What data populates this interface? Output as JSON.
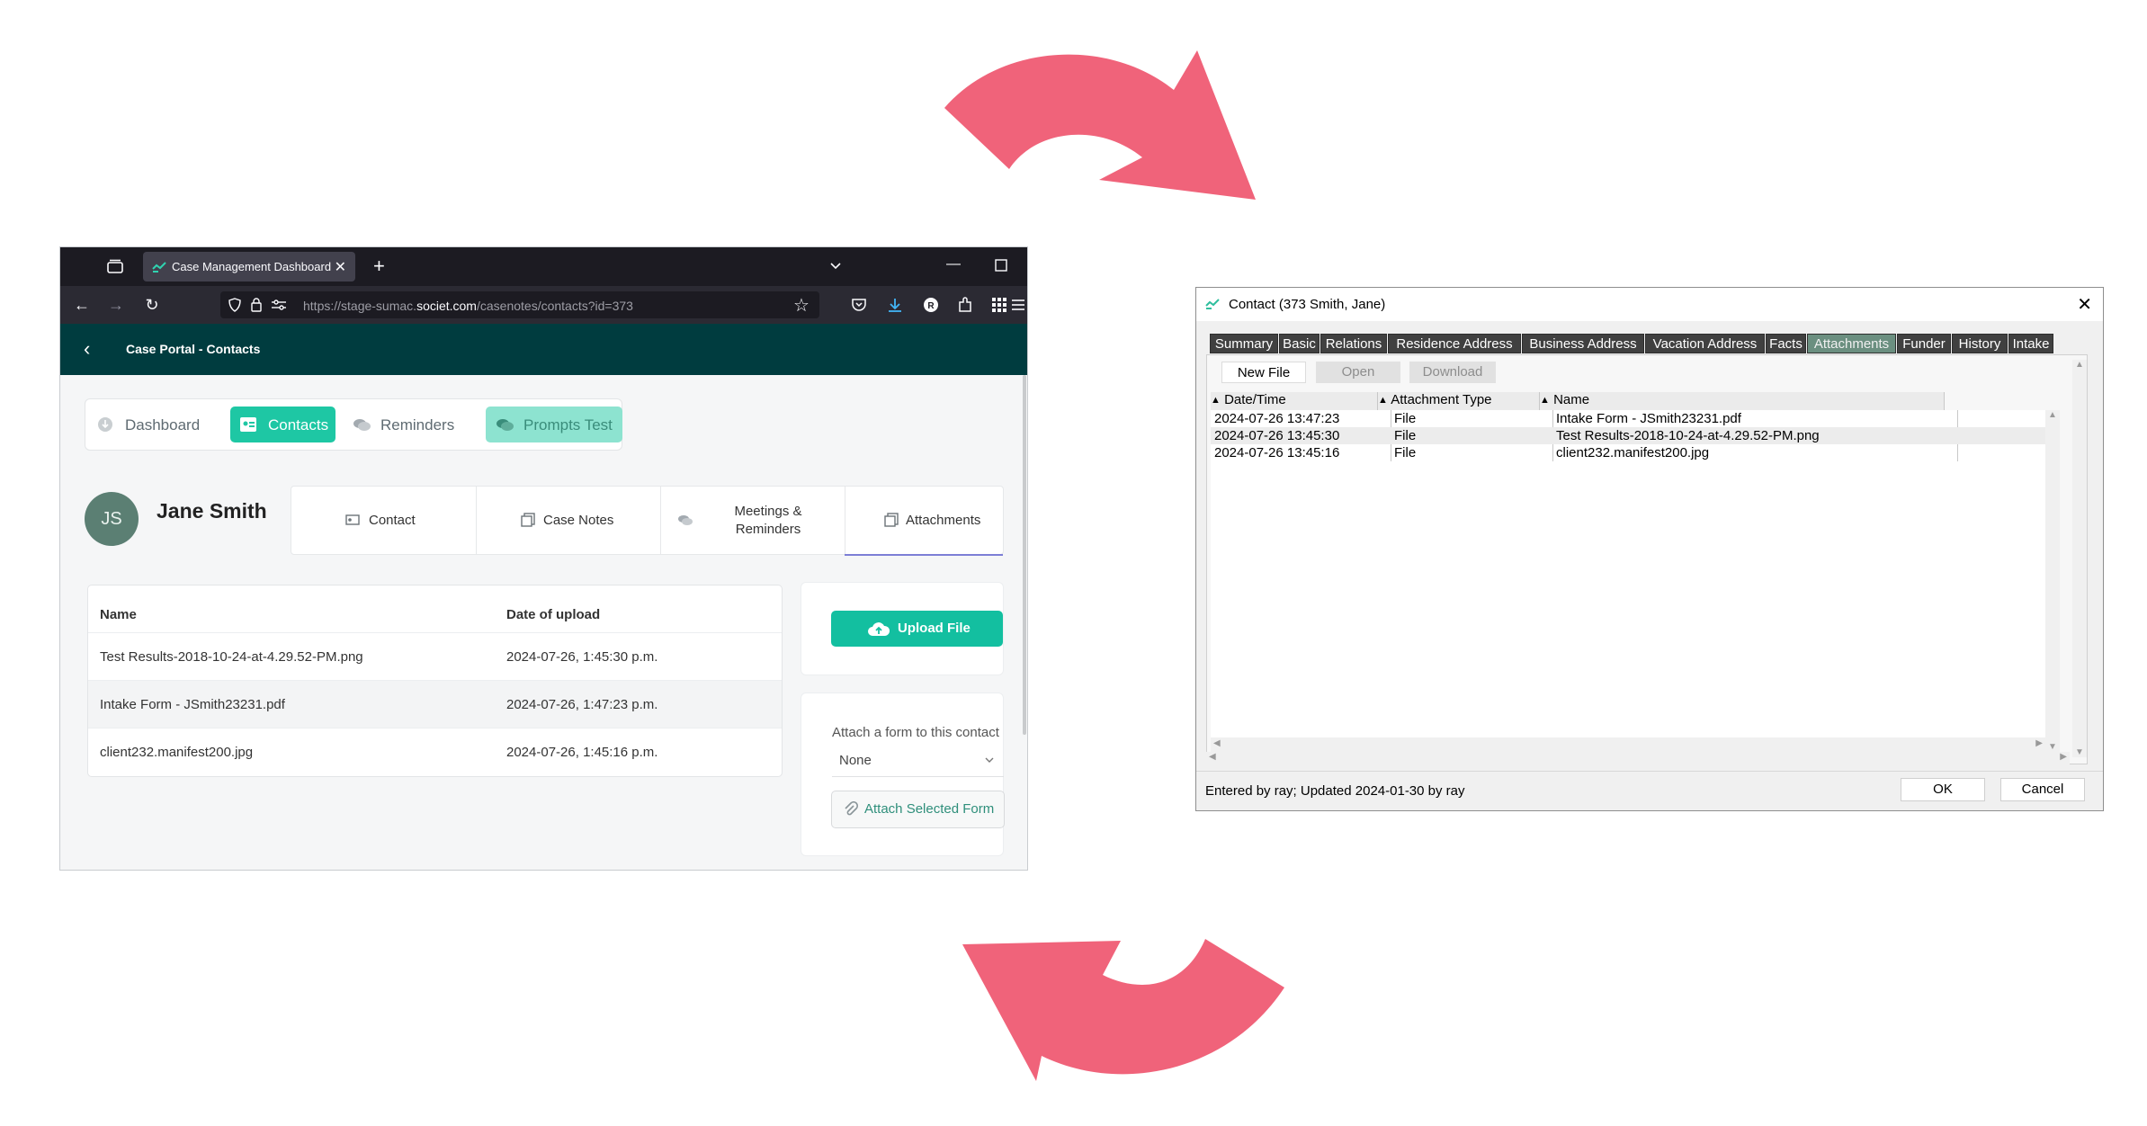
{
  "colors": {
    "arrow": "#f0637a",
    "browser_chrome": "#1c1b22",
    "app_header": "#003c3f",
    "accent": "#1ec7a4",
    "dialog_tab": "#404040",
    "dialog_tab_active": "#6b8f80"
  },
  "arrows": {
    "icon": "curved-arrow-icon",
    "count": 2
  },
  "browser": {
    "tab_title": "Case Management Dashboard",
    "url_prefix": "https://stage-sumac.",
    "url_domain": "societ.com",
    "url_path": "/casenotes/contacts?id=373",
    "icons": [
      "tab-list-icon",
      "close-icon",
      "plus-icon",
      "chevron-down-icon",
      "minimize-icon",
      "maximize-icon",
      "back-icon",
      "forward-icon",
      "reload-icon",
      "shield-icon",
      "lock-icon",
      "permissions-icon",
      "star-icon",
      "pocket-icon",
      "download-icon",
      "profile-icon",
      "extensions-icon",
      "apps-icon",
      "menu-icon"
    ]
  },
  "app": {
    "header_title": "Case Portal - Contacts",
    "nav": [
      "Dashboard",
      "Contacts",
      "Reminders",
      "Prompts Test"
    ],
    "avatar_initials": "JS",
    "contact_name": "Jane Smith",
    "subtabs": [
      {
        "label": "Contact"
      },
      {
        "label": "Case Notes"
      },
      {
        "label_line1": "Meetings &",
        "label_line2": "Reminders"
      },
      {
        "label": "Attachments"
      }
    ],
    "table": {
      "headers": [
        "Name",
        "Date of upload"
      ],
      "rows": [
        [
          "Test Results-2018-10-24-at-4.29.52-PM.png",
          "2024-07-26, 1:45:30 p.m."
        ],
        [
          "Intake Form - JSmith23231.pdf",
          "2024-07-26, 1:47:23 p.m."
        ],
        [
          "client232.manifest200.jpg",
          "2024-07-26, 1:45:16 p.m."
        ]
      ]
    },
    "upload_label": "Upload File",
    "attach_label": "Attach a form to this contact",
    "attach_select_value": "None",
    "attach_button": "Attach Selected Form"
  },
  "dialog": {
    "title": "Contact (373   Smith, Jane)",
    "tabs": [
      "Summary",
      "Basic",
      "Relations",
      "Residence Address",
      "Business Address",
      "Vacation Address",
      "Facts",
      "Attachments",
      "Funder",
      "History",
      "Intake"
    ],
    "active_tab": "Attachments",
    "toolbar": [
      "New File",
      "Open",
      "Download"
    ],
    "columns": [
      "Date/Time",
      "Attachment Type",
      "Name"
    ],
    "rows": [
      [
        "2024-07-26 13:47:23",
        "File",
        "Intake Form - JSmith23231.pdf"
      ],
      [
        "2024-07-26 13:45:30",
        "File",
        "Test Results-2018-10-24-at-4.29.52-PM.png"
      ],
      [
        "2024-07-26 13:45:16",
        "File",
        "client232.manifest200.jpg"
      ]
    ],
    "status": "Entered by ray; Updated 2024-01-30 by ray",
    "ok": "OK",
    "cancel": "Cancel"
  }
}
